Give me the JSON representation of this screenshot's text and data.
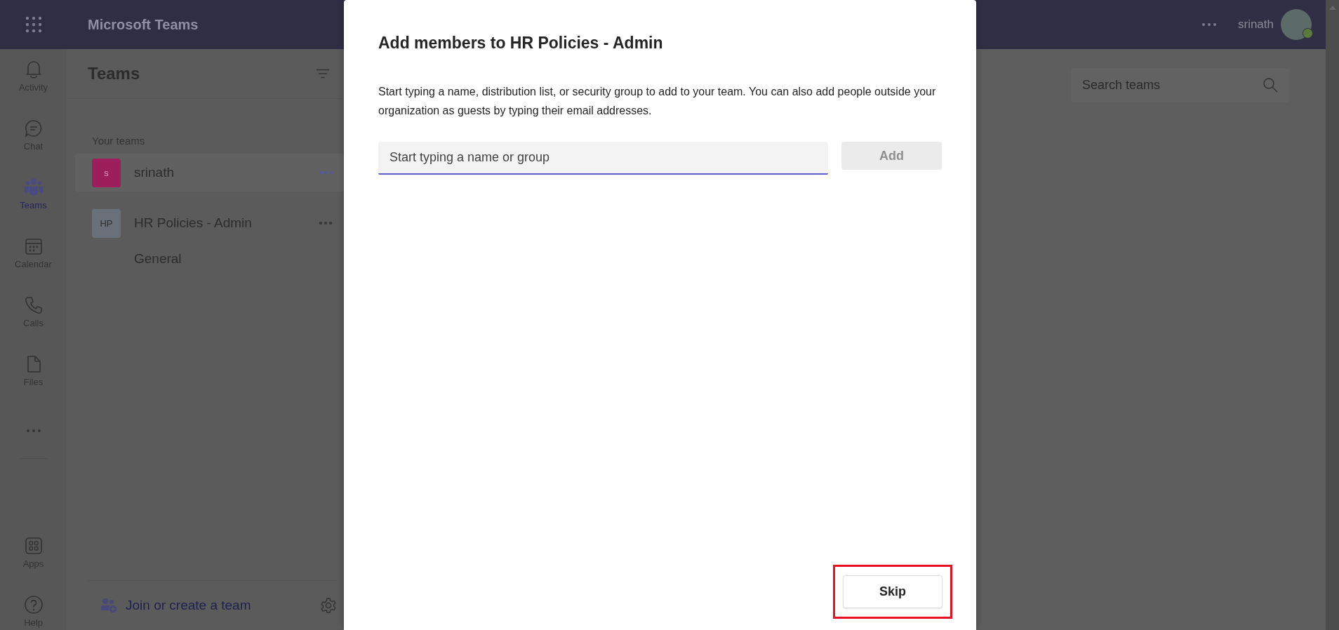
{
  "app": {
    "title": "Microsoft Teams",
    "user_name": "srinath"
  },
  "rail": [
    {
      "kind": "activity",
      "label": "Activity",
      "selected": false
    },
    {
      "kind": "chat",
      "label": "Chat",
      "selected": false
    },
    {
      "kind": "teams",
      "label": "Teams",
      "selected": true
    },
    {
      "kind": "calendar",
      "label": "Calendar",
      "selected": false
    },
    {
      "kind": "calls",
      "label": "Calls",
      "selected": false
    },
    {
      "kind": "files",
      "label": "Files",
      "selected": false
    }
  ],
  "rail_bottom": [
    {
      "kind": "apps",
      "label": "Apps",
      "selected": false
    },
    {
      "kind": "help",
      "label": "Help",
      "selected": false
    }
  ],
  "teams_panel": {
    "title": "Teams",
    "section": "Your teams",
    "join": "Join or create a team",
    "teams": [
      {
        "initials": "s",
        "name": "srinath",
        "color": "#9c1f5b",
        "selected": true
      },
      {
        "initials": "HP",
        "name": "HR Policies - Admin",
        "color": "#69707a",
        "selected": false,
        "channels": [
          "General"
        ]
      }
    ]
  },
  "search": {
    "placeholder": "Search teams"
  },
  "dialog": {
    "title": "Add members to HR Policies - Admin",
    "description": "Start typing a name, distribution list, or security group to add to your team. You can also add people outside your organization as guests by typing their email addresses.",
    "input": {
      "placeholder": "Start typing a name or group",
      "focused": true
    },
    "add_button": {
      "label": "Add",
      "disabled": true
    },
    "skip_button": {
      "label": "Skip",
      "highlighted": true
    }
  }
}
